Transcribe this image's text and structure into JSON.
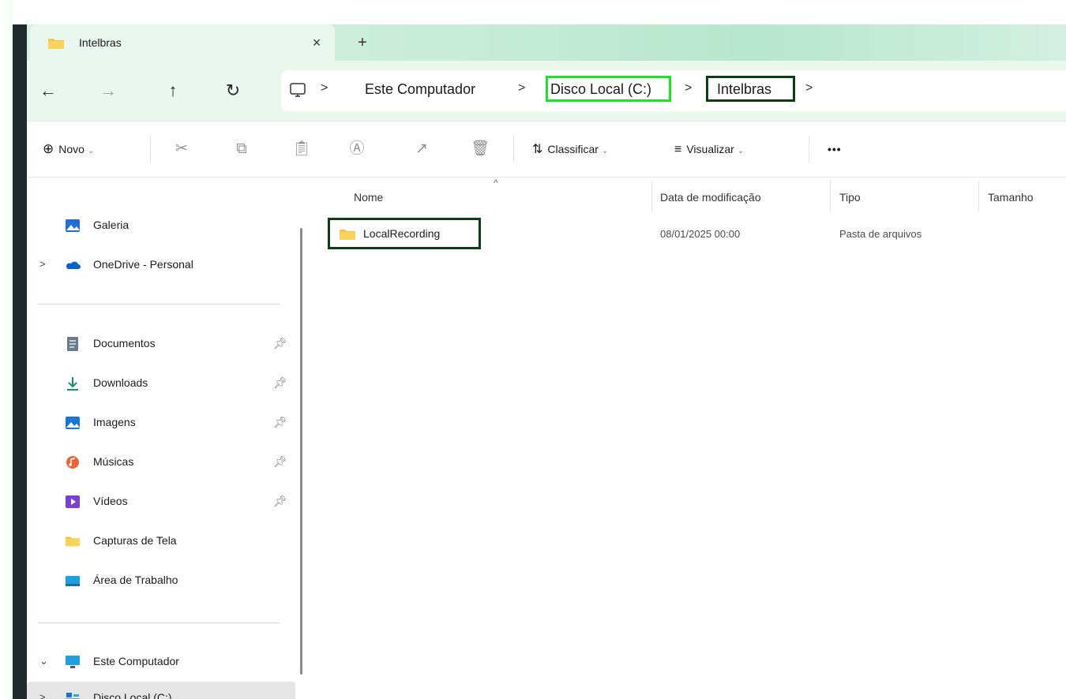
{
  "tab": {
    "title": "Intelbras",
    "close": "×",
    "new": "+"
  },
  "nav_buttons": {
    "back": "←",
    "forward": "→",
    "up": "↑",
    "refresh": "↻"
  },
  "breadcrumb": {
    "sep": ">",
    "items": [
      "Este Computador",
      "Disco Local (C:)",
      "Intelbras"
    ]
  },
  "command_bar": {
    "new_label": "Novo",
    "sort_label": "Classificar",
    "view_label": "Visualizar",
    "more_label": "•••"
  },
  "sidebar": {
    "gallery": "Galeria",
    "onedrive": "OneDrive - Personal",
    "quick_access": [
      "Documentos",
      "Downloads",
      "Imagens",
      "Músicas",
      "Vídeos",
      "Capturas de Tela",
      "Área de Trabalho"
    ],
    "this_pc": "Este Computador",
    "local_disk": "Disco Local (C:)"
  },
  "columns": {
    "name": "Nome",
    "date": "Data de modificação",
    "type": "Tipo",
    "size": "Tamanho"
  },
  "files": [
    {
      "name": "LocalRecording",
      "date": "08/01/2025 00:00",
      "type": "Pasta de arquivos",
      "size": ""
    }
  ],
  "colors": {
    "highlight_current_drive": "#22e02a",
    "highlight_dark": "#0f3d12",
    "folder": "#f4c542"
  }
}
